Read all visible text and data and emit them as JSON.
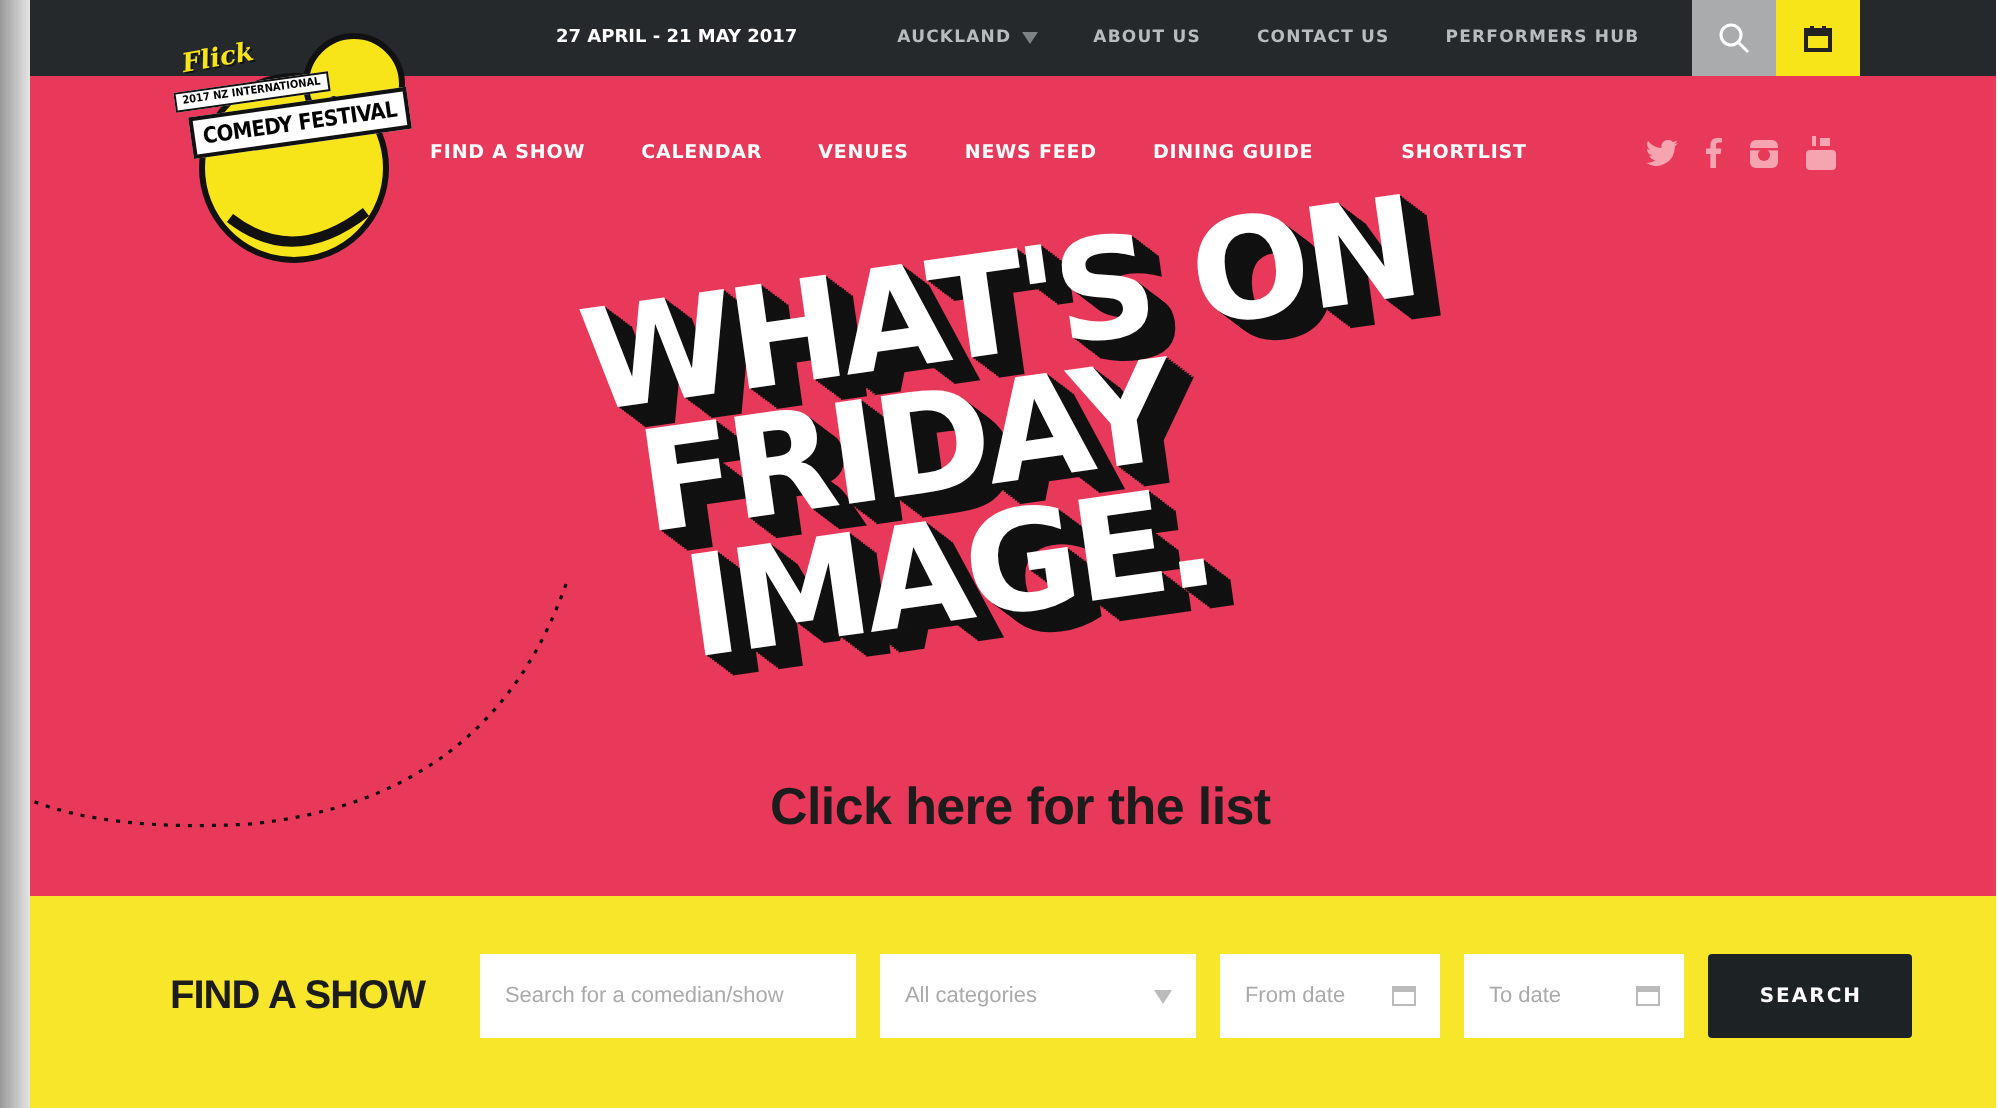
{
  "top_bar": {
    "date": "27 APRIL - 21 MAY 2017",
    "links": [
      {
        "label": "AUCKLAND",
        "kind": "dropdown"
      },
      {
        "label": "ABOUT US",
        "kind": "link"
      },
      {
        "label": "CONTACT US",
        "kind": "link"
      },
      {
        "label": "PERFORMERS HUB",
        "kind": "link"
      }
    ]
  },
  "logo": {
    "brand": "Flick",
    "subtitle": "2017 NZ INTERNATIONAL",
    "title": "COMEDY FESTIVAL"
  },
  "nav": [
    "FIND A SHOW",
    "CALENDAR",
    "VENUES",
    "NEWS FEED",
    "DINING GUIDE",
    "SHORTLIST"
  ],
  "hero": {
    "headline": [
      "WHAT'S ON",
      "FRIDAY",
      "IMAGE."
    ],
    "link": "Click here for the list"
  },
  "finder": {
    "title": "FIND A SHOW",
    "fields": [
      {
        "kind": "text",
        "placeholder": "Search for a comedian/show"
      },
      {
        "kind": "select",
        "value": "All categories"
      },
      {
        "kind": "date",
        "placeholder": "From date"
      },
      {
        "kind": "date",
        "placeholder": "To date"
      }
    ],
    "button": "SEARCH"
  }
}
